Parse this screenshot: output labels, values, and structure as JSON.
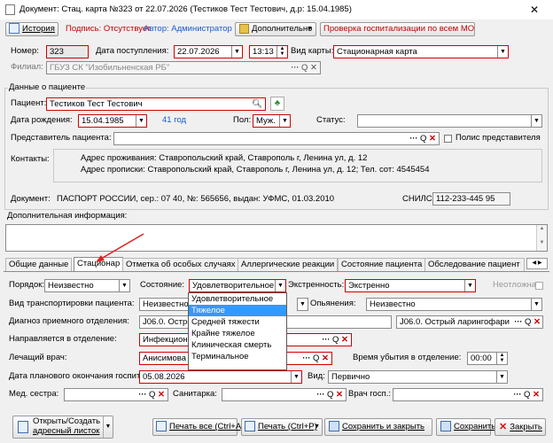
{
  "window": {
    "title": "Документ: Стац. карта №323 от 22.07.2026 (Тестиков Тест Тестович, д.р: 15.04.1985)",
    "close": "✕"
  },
  "toolbar": {
    "history": "История",
    "signature": "Подпись: Отсутствует",
    "author": "Автор: Администратор",
    "additional": "Дополнительно",
    "hosp_check": "Проверка госпитализации по всем МО"
  },
  "header": {
    "number_label": "Номер:",
    "number": "323",
    "admission_label": "Дата поступления:",
    "admission_date": "22.07.2026",
    "admission_time": "13:13",
    "card_type_label": "Вид карты:",
    "card_type": "Стационарная карта",
    "branch_label": "Филиал:",
    "branch": "ГБУЗ СК \"Изобильненская РБ\""
  },
  "patient": {
    "section_title": "Данные о пациенте",
    "patient_label": "Пациент:",
    "patient": "Тестиков Тест Тестович",
    "dob_label": "Дата рождения:",
    "dob": "15.04.1985",
    "age": "41 год",
    "sex_label": "Пол:",
    "sex": "Муж.",
    "status_label": "Статус:",
    "status": "",
    "rep_label": "Представитель пациента:",
    "rep": "",
    "rep_policy": "Полис представителя",
    "contacts_label": "Контакты:",
    "address_live": "Адрес проживания: Ставропольский край, Ставрополь г, Ленина ул, д. 12",
    "address_reg": "Адрес прописки: Ставропольский край, Ставрополь г, Ленина ул, д. 12; Тел. сот: 4545454",
    "doc_label": "Документ:",
    "doc": "ПАСПОРТ РОССИИ, сер.: 07 40, №: 565656, выдан: УФМС, 01.03.2010",
    "snils_label": "СНИЛС:",
    "snils": "112-233-445 95"
  },
  "extra": {
    "title": "Дополнительная информация:"
  },
  "tabs": [
    "Общие данные",
    "Стационар",
    "Отметка об особых случаях",
    "Аллергические реакции",
    "Состояние пациента",
    "Обследование пациент"
  ],
  "hosp": {
    "order_label": "Порядок:",
    "order": "Неизвестно",
    "state_label": "Состояние:",
    "state": "Удовлетворительное",
    "urgency_label": "Экстренность:",
    "urgency": "Экстренно",
    "urgent_label": "Неотложная:",
    "transport_label": "Вид транспортировки пациента:",
    "transport": "Неизвестно",
    "intox_label": "Опьянения:",
    "intox": "Неизвестно",
    "diag_label": "Диагноз приемного отделения:",
    "diag": "J06.0. Острый ларинг",
    "diag2": "J06.0. Острый ларингофари",
    "dept_label": "Направляется в отделение:",
    "dept": "Инфекционн",
    "doctor_label": "Лечащий врач:",
    "doctor": "Анисимова",
    "leave_time_label": "Время убытия в отделение:",
    "leave_time": "00:00",
    "end_date_label": "Дата планового окончания госпитализации:",
    "end_date": "05.08.2026",
    "kind_label": "Вид:",
    "kind": "Первично",
    "nurse_label": "Мед. сестра:",
    "orderly_label": "Санитарка:",
    "resident_label": "Врач госп.:"
  },
  "state_options": [
    "Удовлетворительное",
    "Тяжелое",
    "Средней тяжести",
    "Крайне тяжелое",
    "Клиническая смерть",
    "Терминальное"
  ],
  "footer": {
    "open_create": "Открыть/Создать",
    "address_sheet": "адресный листок",
    "print_all": "Печать все (Ctrl+A)",
    "print": "Печать (Ctrl+P)",
    "save_close": "Сохранить и закрыть",
    "save": "Сохранить",
    "close": "Закрыть"
  },
  "colors": {
    "accent_red": "#d00000",
    "link_blue": "#1a5bd0",
    "selection": "#3399ff"
  }
}
